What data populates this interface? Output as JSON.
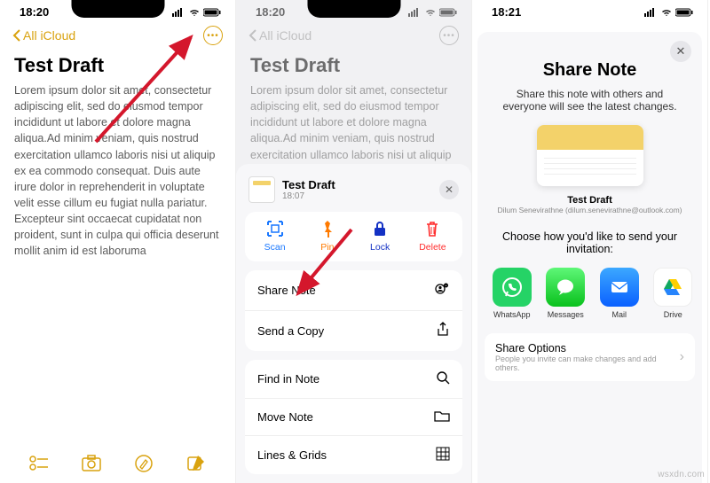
{
  "status": {
    "time": "18:20",
    "time3": "18:21"
  },
  "screen1": {
    "back": "All iCloud",
    "title": "Test Draft",
    "body": "Lorem ipsum dolor sit amet, consectetur adipiscing elit, sed do eiusmod tempor incididunt ut labore et dolore magna aliqua.Ad minim veniam, quis nostrud exercitation ullamco laboris nisi ut aliquip ex ea commodo consequat. Duis aute irure dolor in reprehenderit in voluptate velit esse cillum eu fugiat nulla pariatur. Excepteur sint occaecat cupidatat non proident, sunt in culpa qui officia deserunt mollit anim id est laboruma"
  },
  "screen2": {
    "sheet_title": "Test Draft",
    "sheet_time": "18:07",
    "actions": {
      "scan": "Scan",
      "pin": "Pin",
      "lock": "Lock",
      "delete": "Delete"
    },
    "menu": {
      "share_note": "Share Note",
      "send_copy": "Send a Copy",
      "find": "Find in Note",
      "move": "Move Note",
      "lines": "Lines & Grids"
    }
  },
  "screen3": {
    "title": "Share Note",
    "subtitle": "Share this note with others and everyone will see the latest changes.",
    "note_title": "Test Draft",
    "note_author": "Dilum Senevirathne (dilum.senevirathne@outlook.com)",
    "invite": "Choose how you'd like to send your invitation:",
    "apps": {
      "whatsapp": "WhatsApp",
      "messages": "Messages",
      "mail": "Mail",
      "drive": "Drive"
    },
    "share_options": "Share Options",
    "share_options_sub": "People you invite can make changes and add others."
  },
  "watermark": "wsxdn.com"
}
